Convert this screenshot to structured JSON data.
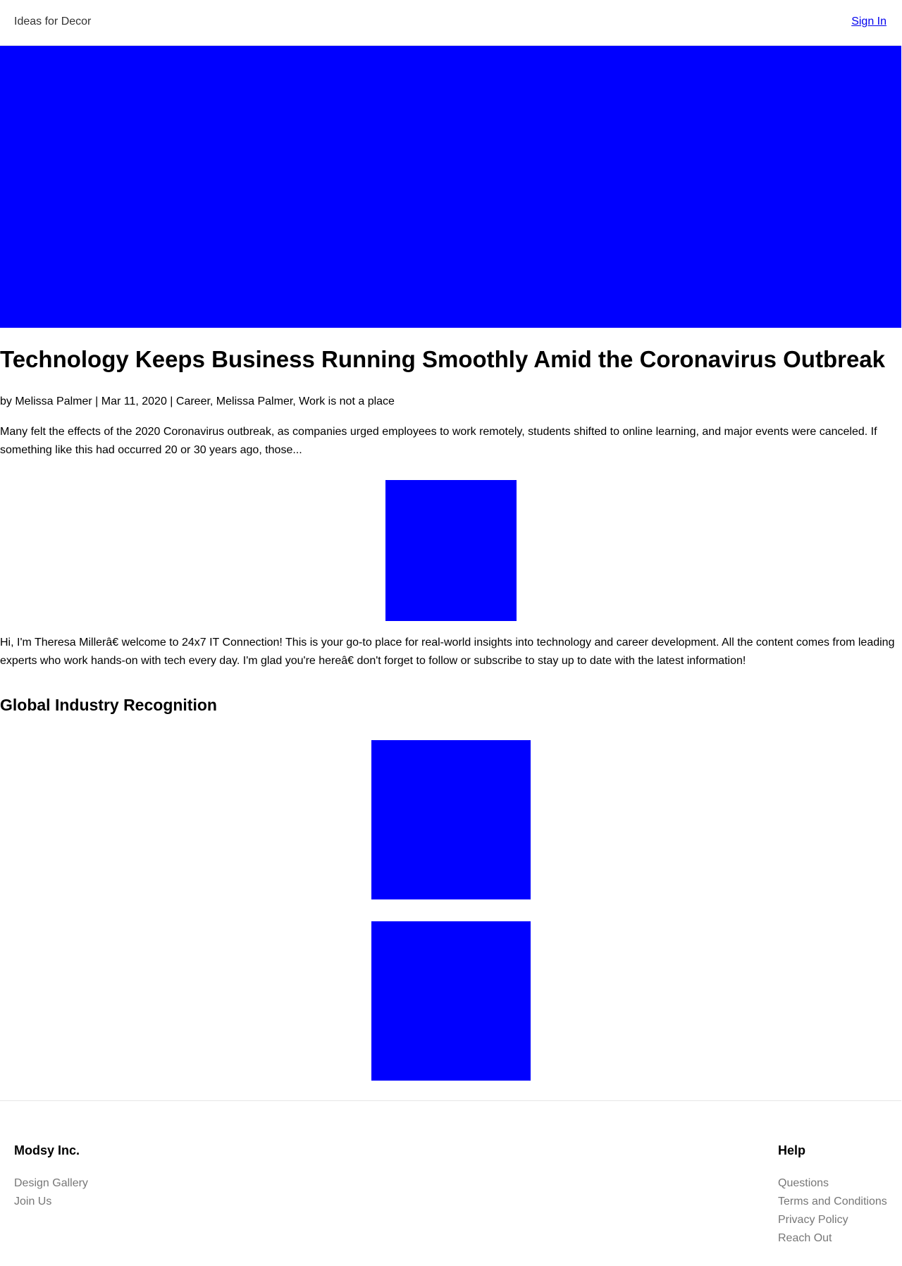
{
  "header": {
    "brand": "Ideas for Decor",
    "signin_label": "Sign In"
  },
  "colors": {
    "placeholder_image": "#0000ff",
    "link": "#0000ee",
    "footer_link": "#777777"
  },
  "article": {
    "title": "Technology Keeps Business Running Smoothly Amid the Coronavirus Outbreak",
    "meta": "by Melissa Palmer | Mar 11, 2020 | Career, Melissa Palmer, Work is not a place",
    "excerpt": "Many felt the effects of the 2020 Coronavirus outbreak, as companies urged employees to work remotely, students shifted to online learning, and major events were canceled. If something like this had occurred 20 or 30 years ago, those...",
    "bio": "Hi, I'm Theresa Millerâ€    welcome to 24x7 IT Connection! This is your go-to place for real-world insights into technology and career development. All the content comes from leading experts who work hands-on with tech every day. I'm glad you're hereâ€    don't forget to follow or subscribe to stay up to date with the latest information!"
  },
  "recognition": {
    "title": "Global Industry Recognition"
  },
  "footer": {
    "left": {
      "heading": "Modsy Inc.",
      "links": [
        "Design Gallery",
        "Join Us"
      ]
    },
    "right": {
      "heading": "Help",
      "links": [
        "Questions",
        "Terms and Conditions",
        "Privacy Policy",
        "Reach Out"
      ]
    }
  }
}
